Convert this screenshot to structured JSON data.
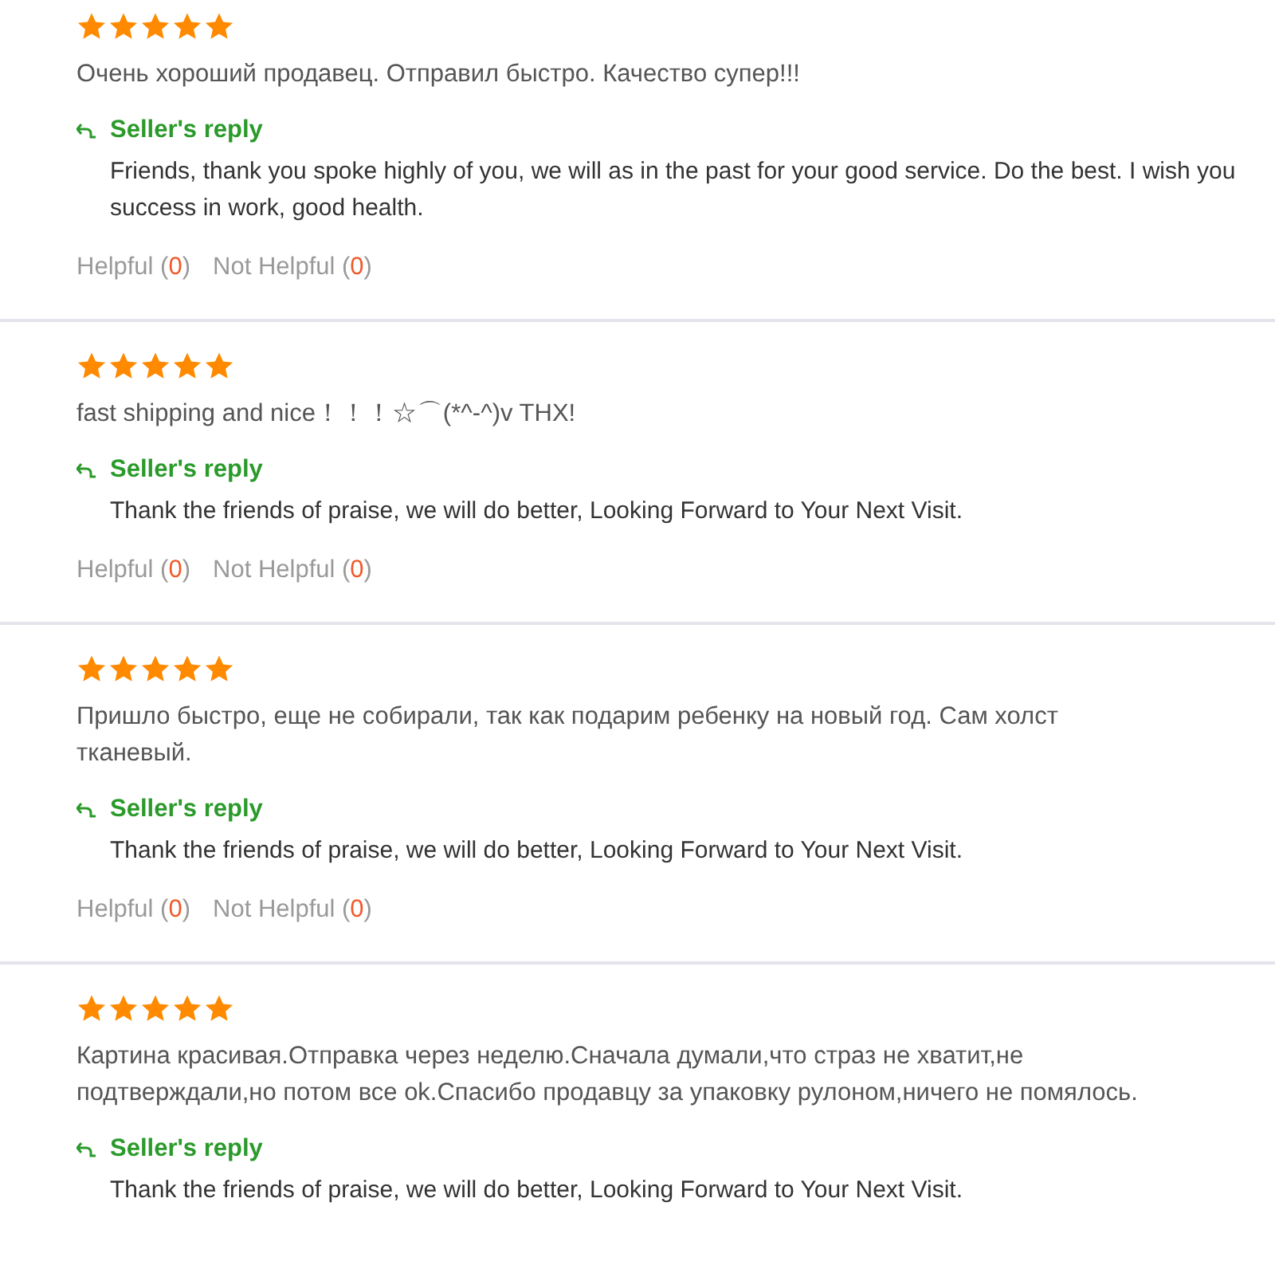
{
  "reviews": [
    {
      "stars": 5,
      "text": "Очень хороший продавец. Отправил быстро. Качество супер!!!",
      "reply_label": "Seller's reply",
      "reply": "Friends, thank you spoke highly of you, we will as in the past for your good service. Do the best. I wish you success in work, good health.",
      "helpful": {
        "label": "Helpful (",
        "count": "0",
        "close": ")"
      },
      "not_helpful": {
        "label": "Not Helpful (",
        "count": "0",
        "close": ")"
      }
    },
    {
      "stars": 5,
      "text": "fast shipping and nice！！！☆⌒(*^-^)v THX!",
      "reply_label": "Seller's reply",
      "reply": "Thank the friends of praise, we will do better, Looking Forward to Your Next Visit.",
      "helpful": {
        "label": "Helpful (",
        "count": "0",
        "close": ")"
      },
      "not_helpful": {
        "label": "Not Helpful (",
        "count": "0",
        "close": ")"
      }
    },
    {
      "stars": 5,
      "text": "Пришло быстро, еще не собирали, так как подарим ребенку на новый год. Сам холст тканевый.",
      "reply_label": "Seller's reply",
      "reply": "Thank the friends of praise, we will do better, Looking Forward to Your Next Visit.",
      "helpful": {
        "label": "Helpful (",
        "count": "0",
        "close": ")"
      },
      "not_helpful": {
        "label": "Not Helpful (",
        "count": "0",
        "close": ")"
      }
    },
    {
      "stars": 5,
      "text": "Картина красивая.Отправка через неделю.Сначала думали,что страз не хватит,не подтверждали,но потом все ok.Спасибо продавцу за упаковку рулоном,ничего не помялось.",
      "reply_label": "Seller's reply",
      "reply": "Thank the friends of praise, we will do better, Looking Forward to Your Next Visit."
    }
  ]
}
